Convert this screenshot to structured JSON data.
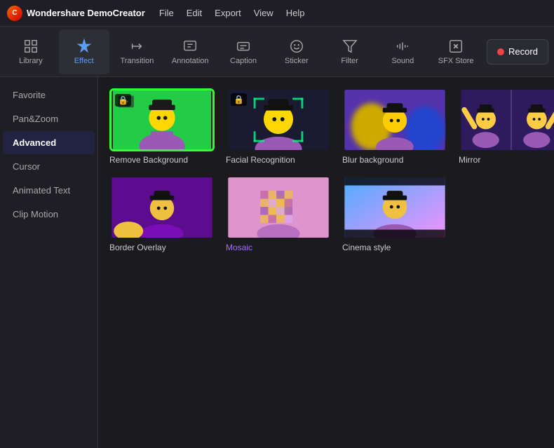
{
  "app": {
    "name": "Wondershare DemoCreator",
    "logo_text": "C"
  },
  "menu": {
    "items": [
      "File",
      "Edit",
      "Export",
      "View",
      "Help"
    ]
  },
  "toolbar": {
    "items": [
      {
        "id": "library",
        "label": "Library",
        "icon": "library"
      },
      {
        "id": "effect",
        "label": "Effect",
        "icon": "effect",
        "active": true
      },
      {
        "id": "transition",
        "label": "Transition",
        "icon": "transition"
      },
      {
        "id": "annotation",
        "label": "Annotation",
        "icon": "annotation"
      },
      {
        "id": "caption",
        "label": "Caption",
        "icon": "caption"
      },
      {
        "id": "sticker",
        "label": "Sticker",
        "icon": "sticker"
      },
      {
        "id": "filter",
        "label": "Filter",
        "icon": "filter"
      },
      {
        "id": "sound",
        "label": "Sound",
        "icon": "sound"
      },
      {
        "id": "sfx",
        "label": "SFX Store",
        "icon": "sfx"
      }
    ],
    "record_label": "Record"
  },
  "sidebar": {
    "items": [
      {
        "id": "favorite",
        "label": "Favorite"
      },
      {
        "id": "pan-zoom",
        "label": "Pan&Zoom"
      },
      {
        "id": "advanced",
        "label": "Advanced",
        "active": true
      },
      {
        "id": "cursor",
        "label": "Cursor"
      },
      {
        "id": "animated-text",
        "label": "Animated Text"
      },
      {
        "id": "clip-motion",
        "label": "Clip Motion"
      }
    ]
  },
  "effects": {
    "items": [
      {
        "id": "remove-bg",
        "label": "Remove Background",
        "locked": true,
        "selected": true,
        "thumb_type": "remove-bg"
      },
      {
        "id": "facial",
        "label": "Facial Recognition",
        "locked": true,
        "selected": false,
        "thumb_type": "facial"
      },
      {
        "id": "blur-bg",
        "label": "Blur background",
        "locked": false,
        "selected": false,
        "thumb_type": "blur"
      },
      {
        "id": "mirror",
        "label": "Mirror",
        "locked": false,
        "selected": false,
        "thumb_type": "mirror"
      },
      {
        "id": "border-overlay",
        "label": "Border Overlay",
        "locked": false,
        "selected": false,
        "thumb_type": "border"
      },
      {
        "id": "mosaic",
        "label": "Mosaic",
        "locked": false,
        "selected": false,
        "thumb_type": "mosaic",
        "label_style": "purple"
      },
      {
        "id": "cinema-style",
        "label": "Cinema style",
        "locked": false,
        "selected": false,
        "thumb_type": "cinema"
      }
    ]
  }
}
